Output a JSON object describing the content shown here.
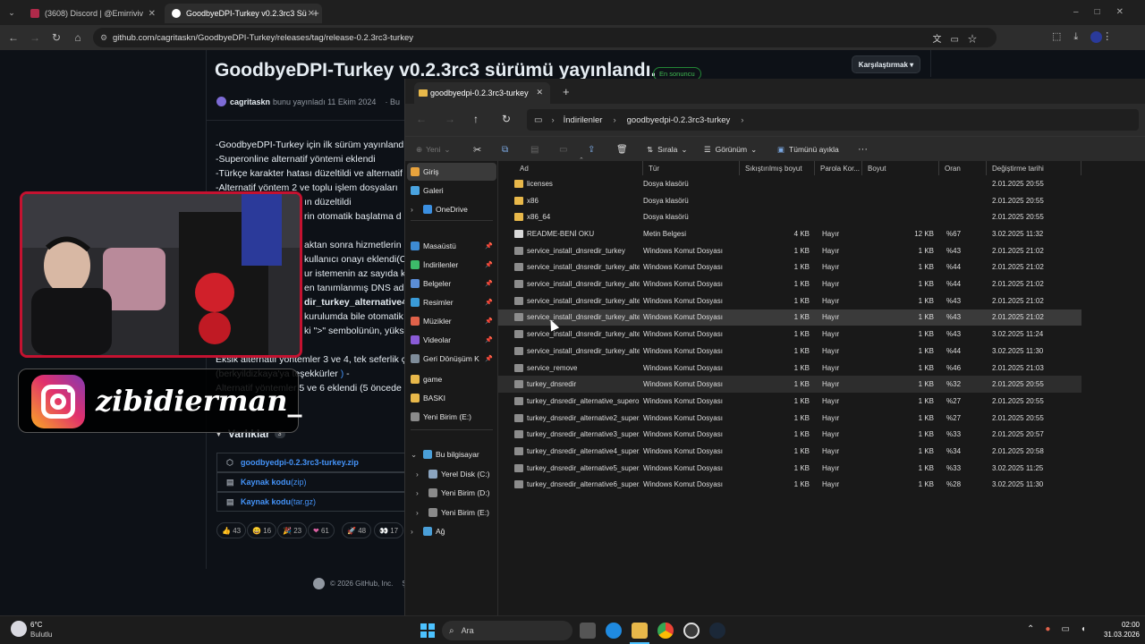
{
  "browser": {
    "tabs": [
      {
        "label": "(3608) Discord | @Emirriviv",
        "close": "✕"
      },
      {
        "label": "GoodbyeDPI-Turkey v0.2.3rc3 Sü",
        "close": "✕"
      }
    ],
    "new_tab": "+",
    "url": "github.com/cagritaskn/GoodbyeDPI-Turkey/releases/tag/release-0.2.3rc3-turkey"
  },
  "github": {
    "title": "GoodbyeDPI-Turkey v0.2.3rc3 sürümü yayınlandı.",
    "badge": "En sonuncu",
    "compare": "Karşılaştırmak ▾",
    "author": "cagritaskn",
    "published": "bunu yayınladı 11 Ekim 2024",
    "published_tail": "· Bu",
    "body_lines": [
      "-GoodbyeDPI-Turkey için ilk sürüm yayınlandı",
      "-Superonline alternatif yöntemi eklendi",
      "-Türkçe karakter hatası düzeltildi ve alternatif",
      "-Alternatif yöntem 2 ve toplu işlem dosyaları",
      "ın düzeltildi",
      "rin otomatik başlatma d",
      "aktan sonra hizmetlerin k",
      "kullanıcı onayı eklendi(C",
      "ur istemenin az sayıda ku",
      "en tanımlanmış DNS adre",
      "dir_turkey_alternative4_",
      "kurulumda bile otomatik",
      "ki \">\" sembolünün, yükse"
    ],
    "line_missing": "Eksik alternatif yöntemler 3 ve 4, tek seferlik ç",
    "line_thanks": "(berkyildizkaya'ya teşekkürler",
    "thanks_link": ")",
    "thanks_tail": " -",
    "line_added": "Alternatif yöntemler 5 ve 6 eklendi (5 öncede",
    "assets_title": "Varlıklar",
    "assets_count": "3",
    "assets": [
      {
        "label": "goodbyedpi-0.2.3rc3-turkey.zip",
        "suffix": ""
      },
      {
        "label": "Kaynak kodu",
        "suffix": " (zip)"
      },
      {
        "label": "Kaynak kodu",
        "suffix": " (tar.gz)"
      }
    ],
    "reactions": [
      {
        "emoji": "👍",
        "count": "43"
      },
      {
        "emoji": "😄",
        "count": "16"
      },
      {
        "emoji": "🎉",
        "count": "23"
      },
      {
        "emoji": "❤",
        "count": "61"
      },
      {
        "emoji": "🚀",
        "count": "48"
      },
      {
        "emoji": "👀",
        "count": "17"
      }
    ],
    "footer": "© 2026 GitHub, Inc.",
    "footer_tail": "Ş"
  },
  "overlay": {
    "instagram_handle": "zibidierman_"
  },
  "explorer": {
    "tab_title": "goodbyedpi-0.2.3rc3-turkey",
    "breadcrumb": [
      "İndirilenler",
      "goodbyedpi-0.2.3rc3-turkey"
    ],
    "commands": {
      "new": "Yeni",
      "sort": "Sırala",
      "view": "Görünüm",
      "select_all": "Tümünü ayıkla",
      "more": "···"
    },
    "nav": [
      {
        "label": "Giriş",
        "color": "#e8a33d",
        "pin": ""
      },
      {
        "label": "Galeri",
        "color": "#4aa3df",
        "pin": ""
      },
      {
        "label": "OneDrive",
        "color": "#3b8fe0",
        "pin": ""
      },
      {
        "label": "Masaüstü",
        "color": "#3d8bd4",
        "pin": "📌"
      },
      {
        "label": "İndirilenler",
        "color": "#3dbb6a",
        "pin": "📌"
      },
      {
        "label": "Belgeler",
        "color": "#5b8dd6",
        "pin": "📌"
      },
      {
        "label": "Resimler",
        "color": "#3a9bd8",
        "pin": "📌"
      },
      {
        "label": "Müzikler",
        "color": "#e0624a",
        "pin": "📌"
      },
      {
        "label": "Videolar",
        "color": "#8a5bd6",
        "pin": "📌"
      },
      {
        "label": "Geri Dönüşüm K",
        "color": "#7f8c99",
        "pin": "📌"
      },
      {
        "label": "game",
        "color": "#e8b84a",
        "pin": ""
      },
      {
        "label": "BASKI",
        "color": "#e8b84a",
        "pin": ""
      },
      {
        "label": "Yeni Birim (E:)",
        "color": "#8a8a8a",
        "pin": ""
      },
      {
        "label": "Bu bilgisayar",
        "color": "#4a9fd8",
        "pin": ""
      },
      {
        "label": "Yerel Disk (C:)",
        "color": "#8aa4bf",
        "pin": ""
      },
      {
        "label": "Yeni Birim (D:)",
        "color": "#8a8a8a",
        "pin": ""
      },
      {
        "label": "Yeni Birim (E:)",
        "color": "#8a8a8a",
        "pin": ""
      },
      {
        "label": "Ağ",
        "color": "#4a9fd8",
        "pin": ""
      }
    ],
    "columns": [
      "Ad",
      "Tür",
      "Sıkıştırılmış boyut",
      "Parola Kor...",
      "Boyut",
      "Oran",
      "Değiştirme tarihi"
    ],
    "files": [
      {
        "name": "licenses",
        "type": "Dosya klasörü",
        "csize": "",
        "pw": "",
        "size": "",
        "ratio": "",
        "date": "2.01.2025 20:55",
        "kind": "folder"
      },
      {
        "name": "x86",
        "type": "Dosya klasörü",
        "csize": "",
        "pw": "",
        "size": "",
        "ratio": "",
        "date": "2.01.2025 20:55",
        "kind": "folder"
      },
      {
        "name": "x86_64",
        "type": "Dosya klasörü",
        "csize": "",
        "pw": "",
        "size": "",
        "ratio": "",
        "date": "2.01.2025 20:55",
        "kind": "folder"
      },
      {
        "name": "README-BENİ OKU",
        "type": "Metin Belgesi",
        "csize": "4 KB",
        "pw": "Hayır",
        "size": "12 KB",
        "ratio": "%67",
        "date": "3.02.2025 11:32",
        "kind": "text"
      },
      {
        "name": "service_install_dnsredir_turkey",
        "type": "Windows Komut Dosyası",
        "csize": "1 KB",
        "pw": "Hayır",
        "size": "1 KB",
        "ratio": "%43",
        "date": "2.01.2025 21:02",
        "kind": "cmd"
      },
      {
        "name": "service_install_dnsredir_turkey_alte...",
        "type": "Windows Komut Dosyası",
        "csize": "1 KB",
        "pw": "Hayır",
        "size": "1 KB",
        "ratio": "%44",
        "date": "2.01.2025 21:02",
        "kind": "cmd"
      },
      {
        "name": "service_install_dnsredir_turkey_alte...",
        "type": "Windows Komut Dosyası",
        "csize": "1 KB",
        "pw": "Hayır",
        "size": "1 KB",
        "ratio": "%44",
        "date": "2.01.2025 21:02",
        "kind": "cmd"
      },
      {
        "name": "service_install_dnsredir_turkey_alte...",
        "type": "Windows Komut Dosyası",
        "csize": "1 KB",
        "pw": "Hayır",
        "size": "1 KB",
        "ratio": "%43",
        "date": "2.01.2025 21:02",
        "kind": "cmd"
      },
      {
        "name": "service_install_dnsredir_turkey_alte...",
        "type": "Windows Komut Dosyası",
        "csize": "1 KB",
        "pw": "Hayır",
        "size": "1 KB",
        "ratio": "%43",
        "date": "2.01.2025 21:02",
        "kind": "cmd",
        "state": "sel"
      },
      {
        "name": "service_install_dnsredir_turkey_alte...",
        "type": "Windows Komut Dosyası",
        "csize": "1 KB",
        "pw": "Hayır",
        "size": "1 KB",
        "ratio": "%43",
        "date": "3.02.2025 11:24",
        "kind": "cmd"
      },
      {
        "name": "service_install_dnsredir_turkey_alte...",
        "type": "Windows Komut Dosyası",
        "csize": "1 KB",
        "pw": "Hayır",
        "size": "1 KB",
        "ratio": "%44",
        "date": "3.02.2025 11:30",
        "kind": "cmd"
      },
      {
        "name": "service_remove",
        "type": "Windows Komut Dosyası",
        "csize": "1 KB",
        "pw": "Hayır",
        "size": "1 KB",
        "ratio": "%46",
        "date": "2.01.2025 21:03",
        "kind": "cmd"
      },
      {
        "name": "turkey_dnsredir",
        "type": "Windows Komut Dosyası",
        "csize": "1 KB",
        "pw": "Hayır",
        "size": "1 KB",
        "ratio": "%32",
        "date": "2.01.2025 20:55",
        "kind": "cmd",
        "state": "hov"
      },
      {
        "name": "turkey_dnsredir_alternative_supero...",
        "type": "Windows Komut Dosyası",
        "csize": "1 KB",
        "pw": "Hayır",
        "size": "1 KB",
        "ratio": "%27",
        "date": "2.01.2025 20:55",
        "kind": "cmd"
      },
      {
        "name": "turkey_dnsredir_alternative2_super...",
        "type": "Windows Komut Dosyası",
        "csize": "1 KB",
        "pw": "Hayır",
        "size": "1 KB",
        "ratio": "%27",
        "date": "2.01.2025 20:55",
        "kind": "cmd"
      },
      {
        "name": "turkey_dnsredir_alternative3_super...",
        "type": "Windows Komut Dosyası",
        "csize": "1 KB",
        "pw": "Hayır",
        "size": "1 KB",
        "ratio": "%33",
        "date": "2.01.2025 20:57",
        "kind": "cmd"
      },
      {
        "name": "turkey_dnsredir_alternative4_super...",
        "type": "Windows Komut Dosyası",
        "csize": "1 KB",
        "pw": "Hayır",
        "size": "1 KB",
        "ratio": "%34",
        "date": "2.01.2025 20:58",
        "kind": "cmd"
      },
      {
        "name": "turkey_dnsredir_alternative5_super...",
        "type": "Windows Komut Dosyası",
        "csize": "1 KB",
        "pw": "Hayır",
        "size": "1 KB",
        "ratio": "%33",
        "date": "3.02.2025 11:25",
        "kind": "cmd"
      },
      {
        "name": "turkey_dnsredir_alternative6_super...",
        "type": "Windows Komut Dosyası",
        "csize": "1 KB",
        "pw": "Hayır",
        "size": "1 KB",
        "ratio": "%28",
        "date": "3.02.2025 11:30",
        "kind": "cmd"
      }
    ]
  },
  "taskbar": {
    "weather_temp": "6°C",
    "weather_desc": "Bulutlu",
    "search_placeholder": "Ara",
    "time": "02:00",
    "date": "31.03.2026"
  },
  "colors": {
    "folder": "#e8b84a",
    "link": "#4493f8",
    "accent_red": "#c41230",
    "selection": "#3a3a3a"
  }
}
